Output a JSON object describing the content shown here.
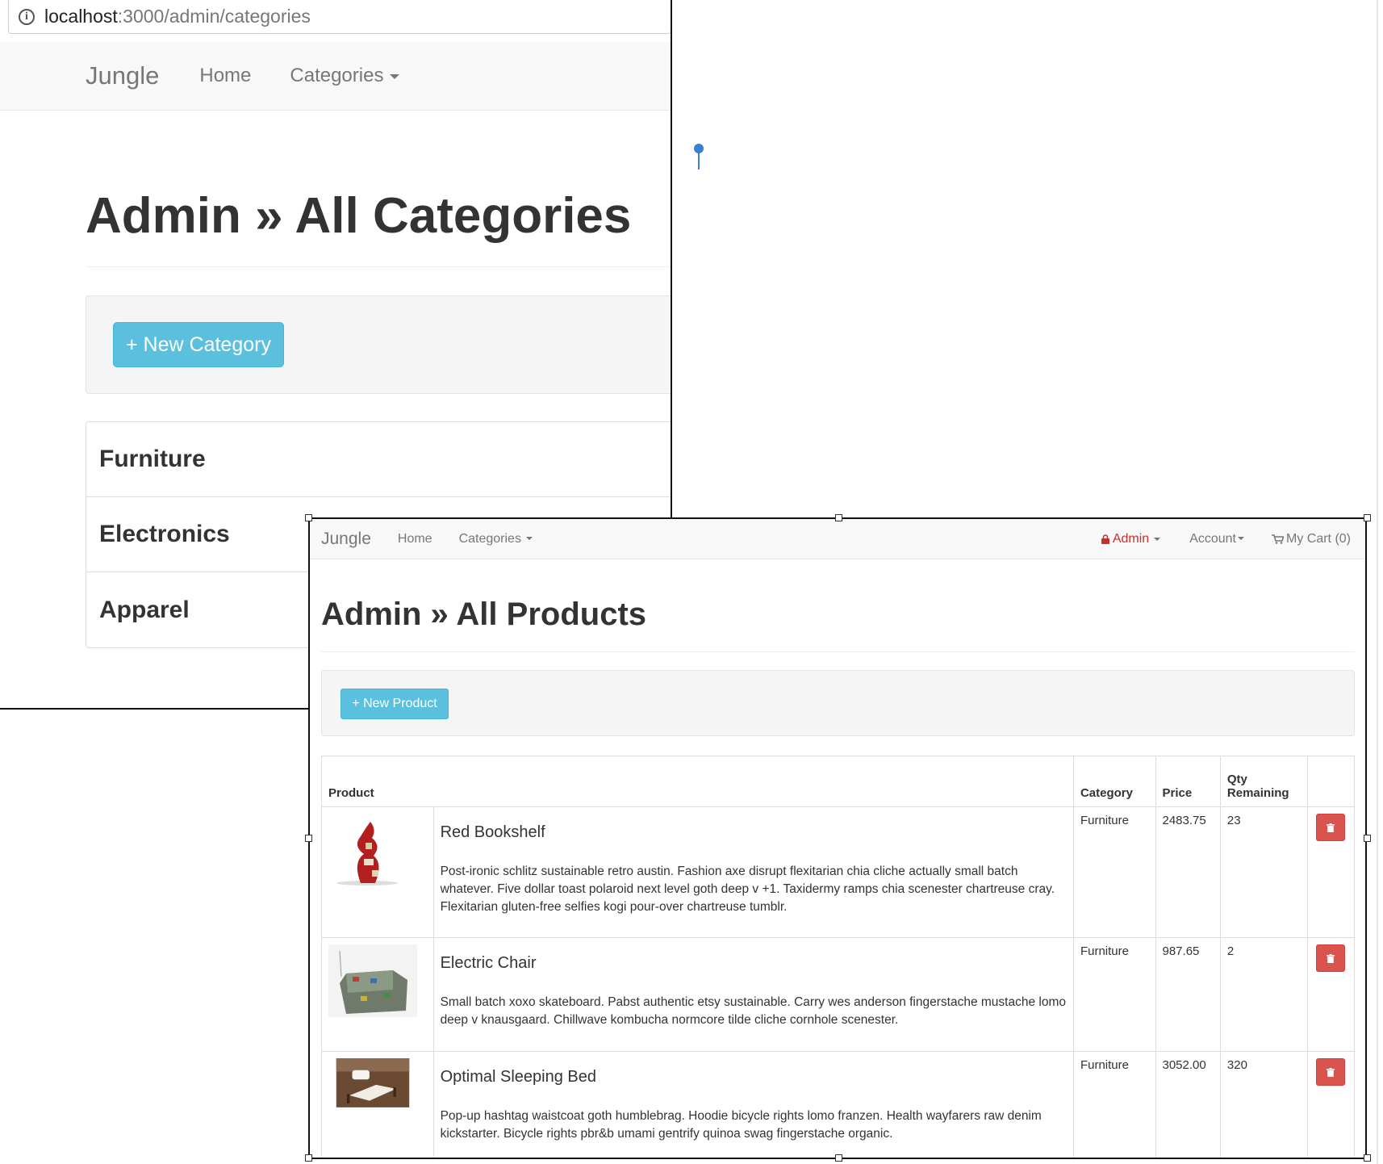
{
  "back_window": {
    "url_host": "localhost",
    "url_path": ":3000/admin/categories",
    "nav": {
      "brand": "Jungle",
      "home": "Home",
      "categories": "Categories"
    },
    "title": "Admin » All Categories",
    "new_button": "+ New Category",
    "categories": [
      "Furniture",
      "Electronics",
      "Apparel"
    ]
  },
  "front_window": {
    "nav": {
      "brand": "Jungle",
      "home": "Home",
      "categories": "Categories",
      "admin": "Admin",
      "account": "Account",
      "cart": "My Cart (0)"
    },
    "title": "Admin » All Products",
    "new_button": "+ New Product",
    "table": {
      "headers": {
        "product": "Product",
        "category": "Category",
        "price": "Price",
        "qty_line1": "Qty",
        "qty_line2": "Remaining"
      },
      "rows": [
        {
          "name": "Red Bookshelf",
          "description": "Post-ironic schlitz sustainable retro austin. Fashion axe disrupt flexitarian chia cliche actually small batch whatever. Five dollar toast polaroid next level goth deep v +1. Taxidermy ramps chia scenester chartreuse cray. Flexitarian gluten-free selfies kogi pour-over chartreuse tumblr.",
          "category": "Furniture",
          "price": "2483.75",
          "qty": "23"
        },
        {
          "name": "Electric Chair",
          "description": "Small batch xoxo skateboard. Pabst authentic etsy sustainable. Carry wes anderson fingerstache mustache lomo deep v knausgaard. Chillwave kombucha normcore tilde cliche cornhole scenester.",
          "category": "Furniture",
          "price": "987.65",
          "qty": "2"
        },
        {
          "name": "Optimal Sleeping Bed",
          "description": "Pop-up hashtag waistcoat goth humblebrag. Hoodie bicycle rights lomo franzen. Health wayfarers raw denim kickstarter. Bicycle rights pbr&b umami gentrify quinoa swag fingerstache organic.",
          "category": "Furniture",
          "price": "3052.00",
          "qty": "320"
        }
      ]
    }
  },
  "colors": {
    "info": "#5bc0de",
    "danger": "#d9534f",
    "admin_red": "#c9302c",
    "nav_bg": "#f8f8f8",
    "well_bg": "#f5f5f5"
  },
  "icons": [
    "info-icon",
    "caret-down-icon",
    "lock-icon",
    "cart-icon",
    "trash-icon",
    "location-pin-icon"
  ]
}
